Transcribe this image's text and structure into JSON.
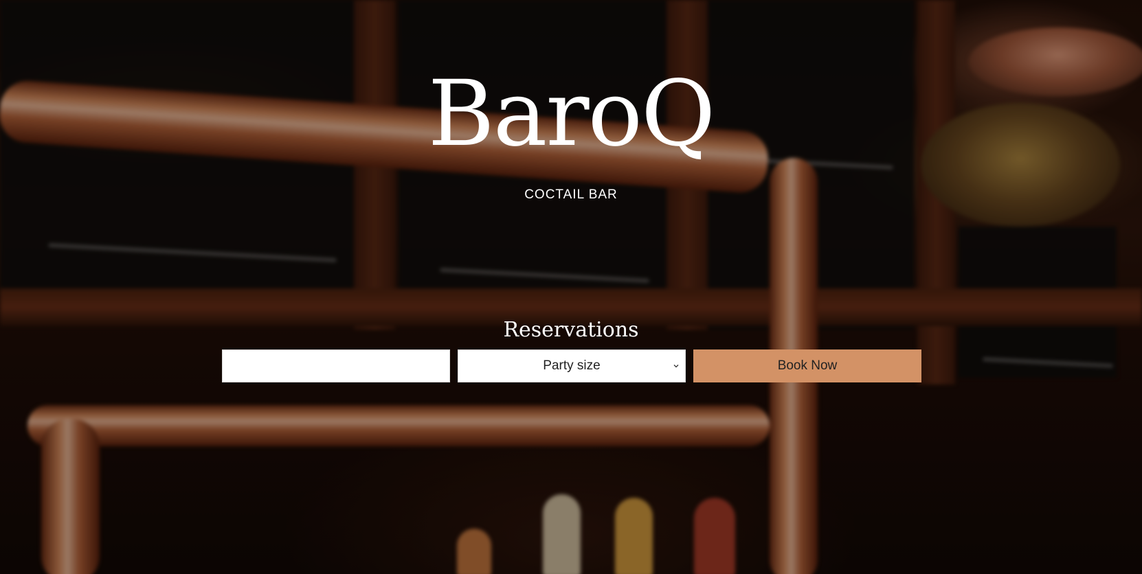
{
  "brand": {
    "name": "BaroQ",
    "tagline": "COCTAIL BAR"
  },
  "reservations": {
    "title": "Reservations",
    "date_input": {
      "value": "",
      "placeholder": ""
    },
    "party_size": {
      "selected": "Party size"
    },
    "book_button_label": "Book Now"
  },
  "colors": {
    "accent": "#d39266",
    "text": "#ffffff"
  },
  "icons": {
    "select_chevron": "chevron-down-icon"
  }
}
